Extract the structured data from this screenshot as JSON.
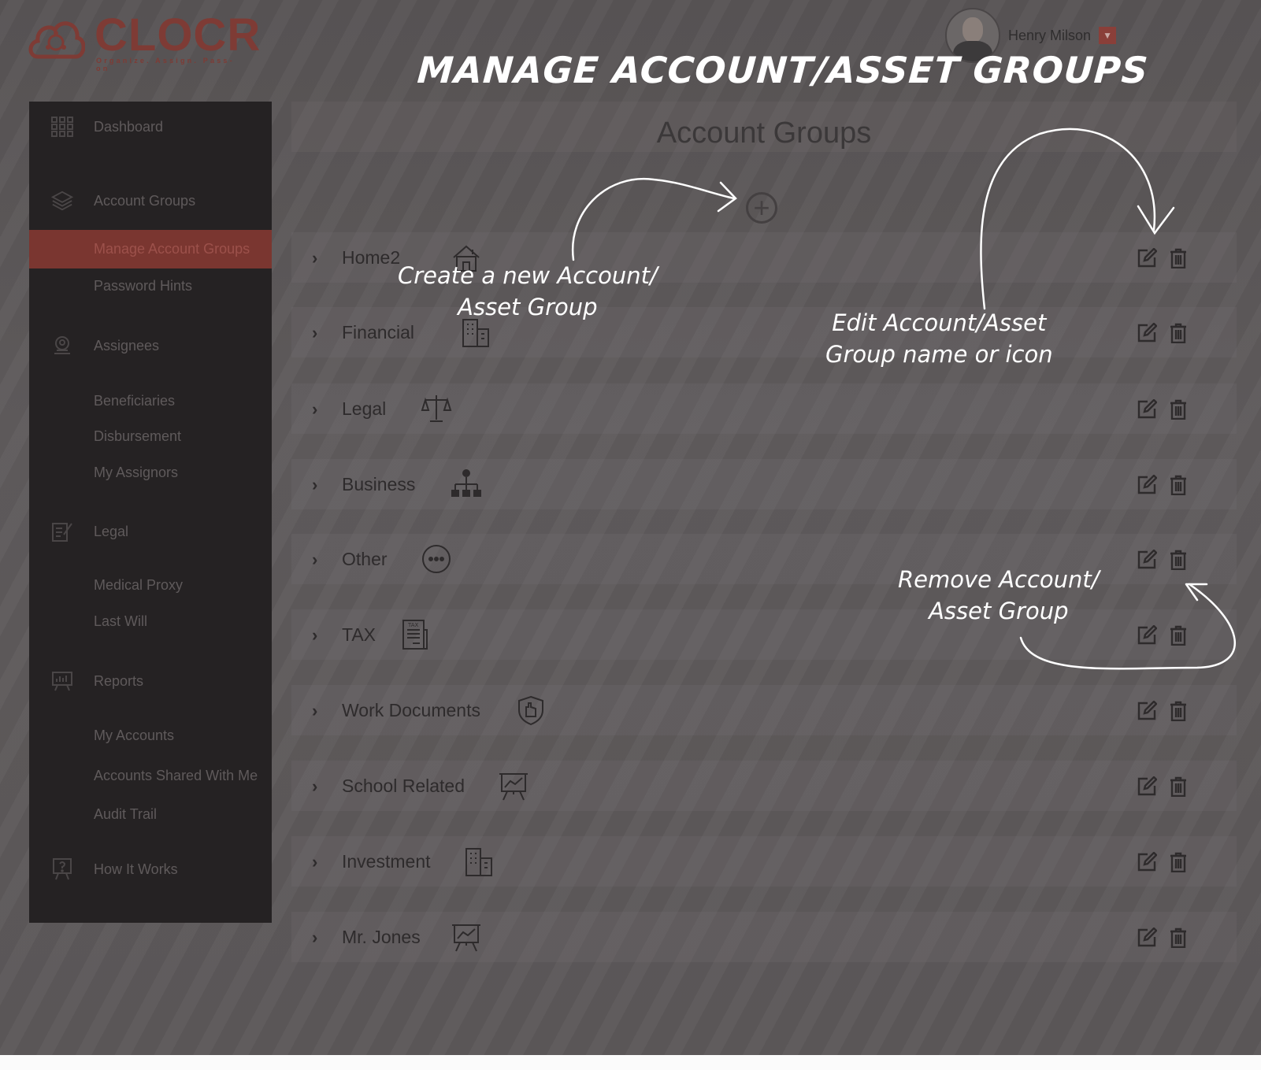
{
  "header": {
    "logo_text": "CLOCR",
    "logo_tagline": "Organize. Assign. Pass-on",
    "user_name": "Henry Milson",
    "page_title": "MANAGE ACCOUNT/ASSET GROUPS"
  },
  "sidebar": {
    "items": [
      {
        "label": "Dashboard",
        "icon": "grid-icon"
      },
      {
        "label": "Account Groups",
        "icon": "layers-icon"
      },
      {
        "label": "Manage Account Groups",
        "icon": ""
      },
      {
        "label": "Password Hints",
        "icon": ""
      },
      {
        "label": "Assignees",
        "icon": "user-badge-icon"
      },
      {
        "label": "Beneficiaries",
        "icon": ""
      },
      {
        "label": "Disbursement",
        "icon": ""
      },
      {
        "label": "My Assignors",
        "icon": ""
      },
      {
        "label": "Legal",
        "icon": "document-edit-icon"
      },
      {
        "label": "Medical Proxy",
        "icon": ""
      },
      {
        "label": "Last Will",
        "icon": ""
      },
      {
        "label": "Reports",
        "icon": "presentation-chart-icon"
      },
      {
        "label": "My Accounts",
        "icon": ""
      },
      {
        "label": "Accounts Shared With Me",
        "icon": ""
      },
      {
        "label": "Audit Trail",
        "icon": ""
      },
      {
        "label": "How It Works",
        "icon": "help-board-icon"
      }
    ],
    "active_index": 2
  },
  "main": {
    "title": "Account Groups",
    "add_icon": "plus-circle-icon",
    "groups": [
      {
        "name": "Home2",
        "icon": "house-icon"
      },
      {
        "name": "Financial",
        "icon": "building-icon"
      },
      {
        "name": "Legal",
        "icon": "scales-icon"
      },
      {
        "name": "Business",
        "icon": "org-chart-icon"
      },
      {
        "name": "Other",
        "icon": "ellipsis-circle-icon"
      },
      {
        "name": "TAX",
        "icon": "tax-document-icon"
      },
      {
        "name": "Work Documents",
        "icon": "hand-shield-icon"
      },
      {
        "name": "School Related",
        "icon": "presentation-board-icon"
      },
      {
        "name": "Investment",
        "icon": "building-icon"
      },
      {
        "name": "Mr. Jones",
        "icon": "presentation-board-icon"
      }
    ],
    "row_actions": {
      "edit_icon": "edit-icon",
      "delete_icon": "trash-icon"
    }
  },
  "annotations": {
    "create_line1": "Create a new Account/",
    "create_line2": "Asset Group",
    "edit_line1": "Edit Account/Asset",
    "edit_line2": "Group name or icon",
    "remove_line1": "Remove Account/",
    "remove_line2": "Asset Group"
  },
  "colors": {
    "overlay_bg": "#5a5657",
    "sidebar_bg": "#252223",
    "active_item": "#7a3630",
    "brand": "#7e3b35",
    "annotation": "#ffffff"
  }
}
